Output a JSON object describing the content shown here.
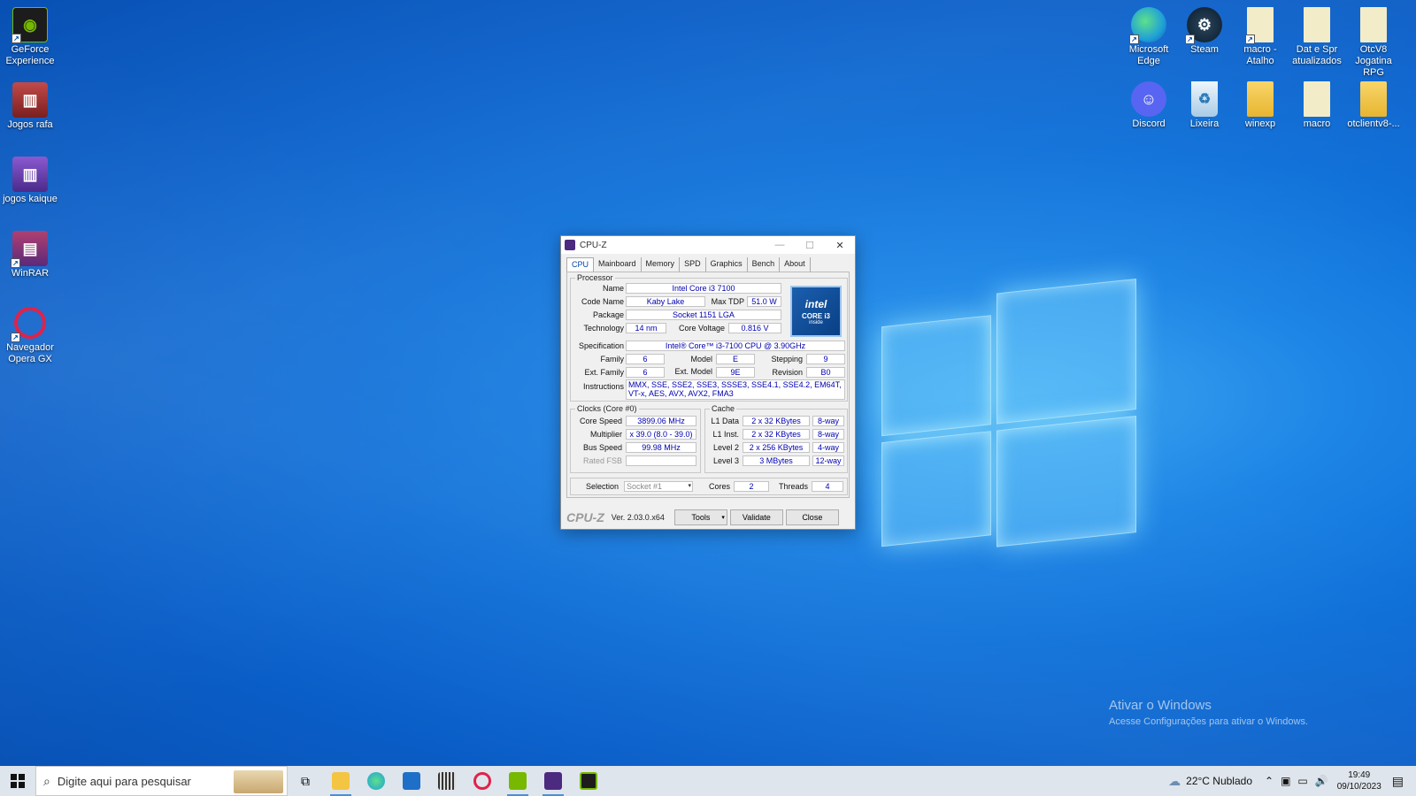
{
  "desktop": {
    "left_icons": [
      {
        "label": "GeForce Experience",
        "icon": "geforce-icon",
        "color": "#76b900"
      },
      {
        "label": "Jogos rafa",
        "icon": "archive-icon",
        "color": "#b03030"
      },
      {
        "label": "jogos kaique",
        "icon": "archive-icon",
        "color": "#6a3ca8"
      },
      {
        "label": "WinRAR",
        "icon": "winrar-icon",
        "color": "#8a2a5a"
      },
      {
        "label": "Navegador Opera GX",
        "icon": "opera-gx-icon",
        "color": "#e0224a"
      }
    ],
    "right_icons": [
      {
        "label": "Microsoft Edge",
        "icon": "edge-icon",
        "color": "#1fa0d8"
      },
      {
        "label": "Steam",
        "icon": "steam-icon",
        "color": "#1b2838"
      },
      {
        "label": "macro - Atalho",
        "icon": "file-icon",
        "color": "#f0e6b8"
      },
      {
        "label": "Dat e Spr atualizados",
        "icon": "file-icon",
        "color": "#f0e6b8"
      },
      {
        "label": "OtcV8 Jogatina RPG",
        "icon": "file-icon",
        "color": "#f0e6b8"
      },
      {
        "label": "Discord",
        "icon": "discord-icon",
        "color": "#5865f2"
      },
      {
        "label": "Lixeira",
        "icon": "recycle-bin-icon",
        "color": "#cfe6f8"
      },
      {
        "label": "winexp",
        "icon": "folder-icon",
        "color": "#f4c542"
      },
      {
        "label": "macro",
        "icon": "file-icon",
        "color": "#f0e6b8"
      },
      {
        "label": "otclientv8-...",
        "icon": "folder-icon",
        "color": "#f4c542"
      }
    ]
  },
  "cpuz": {
    "title": "CPU-Z",
    "tabs": [
      "CPU",
      "Mainboard",
      "Memory",
      "SPD",
      "Graphics",
      "Bench",
      "About"
    ],
    "processor": {
      "group": "Processor",
      "name_label": "Name",
      "name": "Intel Core i3 7100",
      "codename_label": "Code Name",
      "codename": "Kaby Lake",
      "maxtdp_label": "Max TDP",
      "maxtdp": "51.0 W",
      "package_label": "Package",
      "package": "Socket 1151 LGA",
      "technology_label": "Technology",
      "technology": "14 nm",
      "corevoltage_label": "Core Voltage",
      "corevoltage": "0.816 V",
      "spec_label": "Specification",
      "spec": "Intel® Core™ i3-7100 CPU @ 3.90GHz",
      "family_label": "Family",
      "family": "6",
      "model_label": "Model",
      "model": "E",
      "stepping_label": "Stepping",
      "stepping": "9",
      "extfamily_label": "Ext. Family",
      "extfamily": "6",
      "extmodel_label": "Ext. Model",
      "extmodel": "9E",
      "revision_label": "Revision",
      "revision": "B0",
      "instructions_label": "Instructions",
      "instructions": "MMX, SSE, SSE2, SSE3, SSSE3, SSE4.1, SSE4.2, EM64T, VT-x, AES, AVX, AVX2, FMA3"
    },
    "intel_badge": {
      "brand": "intel",
      "line": "CORE i3",
      "sub": "inside"
    },
    "clocks": {
      "group": "Clocks (Core #0)",
      "corespeed_label": "Core Speed",
      "corespeed": "3899.06 MHz",
      "multiplier_label": "Multiplier",
      "multiplier": "x 39.0 (8.0 - 39.0)",
      "busspeed_label": "Bus Speed",
      "busspeed": "99.98 MHz",
      "ratedfsb_label": "Rated FSB",
      "ratedfsb": ""
    },
    "cache": {
      "group": "Cache",
      "rows": [
        {
          "label": "L1 Data",
          "size": "2 x 32 KBytes",
          "way": "8-way"
        },
        {
          "label": "L1 Inst.",
          "size": "2 x 32 KBytes",
          "way": "8-way"
        },
        {
          "label": "Level 2",
          "size": "2 x 256 KBytes",
          "way": "4-way"
        },
        {
          "label": "Level 3",
          "size": "3 MBytes",
          "way": "12-way"
        }
      ]
    },
    "selection_label": "Selection",
    "selection": "Socket #1",
    "cores_label": "Cores",
    "cores": "2",
    "threads_label": "Threads",
    "threads": "4",
    "brand": "CPU-Z",
    "version": "Ver. 2.03.0.x64",
    "tools_label": "Tools",
    "validate_label": "Validate",
    "close_label": "Close"
  },
  "watermark": {
    "title": "Ativar o Windows",
    "subtitle": "Acesse Configurações para ativar o Windows."
  },
  "taskbar": {
    "search_placeholder": "Digite aqui para pesquisar",
    "weather": "22°C  Nublado",
    "time": "19:49",
    "date": "09/10/2023"
  }
}
